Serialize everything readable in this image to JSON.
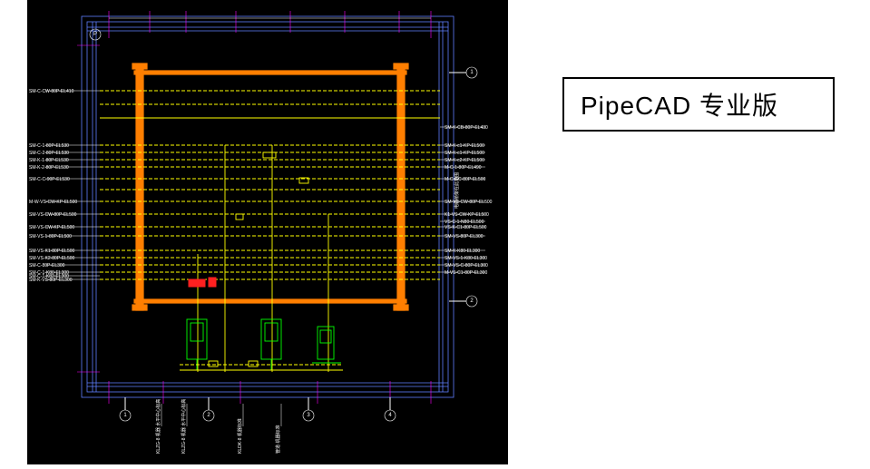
{
  "title_box": "PipeCAD 专业版",
  "grid_axes": {
    "top_row": [
      "P"
    ],
    "right_col": [
      "1",
      "2"
    ],
    "bottom_row": [
      "1",
      "2",
      "3",
      "4"
    ]
  },
  "labels_left": [
    "SM-C-CW-80P-EL410",
    "SM-C-1-80P-EL530",
    "SM-C-2-80P-EL530",
    "SM-K-1-80P-EL530",
    "SM-K-2-80P-EL530",
    "SM-C-C-90P-EL530",
    "M-W-VS-CW-KP-EL500",
    "SM-VS-CW-80P-EL500",
    "SM-VS-CW-KP-EL500",
    "SM-VS-1-80P-EL500",
    "SM-VS-K1-80P-EL500",
    "SM-VS-K2-80P-EL500",
    "SM-C-80P-EL300",
    "SM-C-1-K80-EL300",
    "SM-C-1-K82-EL300",
    "SM-K-VS-80P-EL300"
  ],
  "labels_right": [
    "SM-K-CB-80P-EL430",
    "SM-K-c1-KP-EL500",
    "SM-K-c1-KP-EL500",
    "SM-K-c2-KP-EL500",
    "M-C-1-80P-EL490",
    "M-C-GC-80P-EL500",
    "SM-VS-CW-80P-EL500",
    "K1-VS-CW-KP-EL500",
    "VS-C-1-N80-EL500",
    "VS-K-C1-80P-EL500",
    "SM-VS-80P-EL300",
    "SM-K-K80-EL300",
    "SM-VS-1-K80-EL300",
    "SM-VS-C-80P-EL300",
    "M-VS-C1-80P-EL300"
  ],
  "bottom_notes": [
    "KLZG-8 机器\\n水平中心标高",
    "KLZG-8 机器\\n水平中心标高",
    "KLDK-8 机器标准",
    "管道·机器标准"
  ],
  "right_margin_note": "电缆桥架在此范围"
}
